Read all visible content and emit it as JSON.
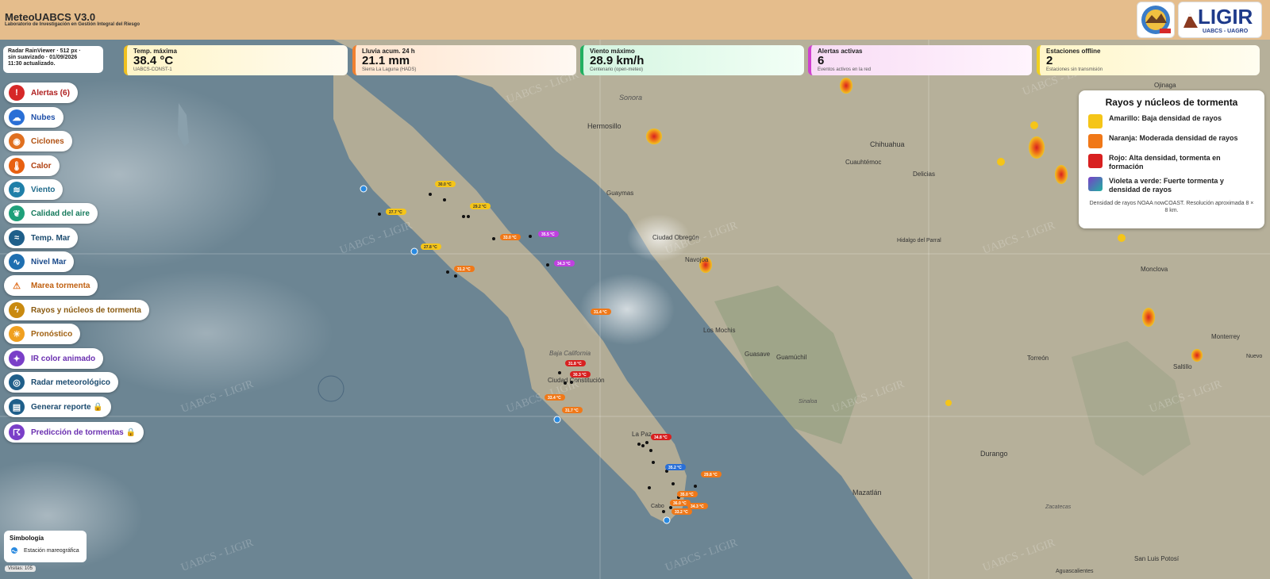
{
  "header": {
    "title": "MeteoUABCS V3.0",
    "subtitle": "Laboratorio de Investigación en Gestión Integral del Riesgo",
    "logo_text": "LIGIR",
    "logo_subtext": "UABCS - UAGRO"
  },
  "radar_info": {
    "line1": "Radar RainViewer · 512 px ·",
    "line2": "sin suavizado · 01/09/2026",
    "line3": "11:30 actualizado."
  },
  "stats": [
    {
      "label": "Temp. máxima",
      "value": "38.4 °C",
      "source": "UABCS-CONST-1",
      "color": "#f0c020"
    },
    {
      "label": "Lluvia acum. 24 h",
      "value": "21.1 mm",
      "source": "Sierra La Laguna (HADS)",
      "color": "#f08030"
    },
    {
      "label": "Viento máximo",
      "value": "28.9 km/h",
      "source": "Centenario (open-meteo)",
      "color": "#20b060"
    },
    {
      "label": "Alertas activas",
      "value": "6",
      "source": "Eventos activos en la red",
      "color": "#d040d0"
    },
    {
      "label": "Estaciones offline",
      "value": "2",
      "source": "Estaciones sin transmisión",
      "color": "#f0d020"
    }
  ],
  "sidebar": [
    {
      "label": "Alertas (6)",
      "icon": "alert-icon",
      "color": "#d62828",
      "text_color": "#b02020"
    },
    {
      "label": "Nubes",
      "icon": "cloud-icon",
      "color": "#2a6fd6",
      "text_color": "#1e4fa8"
    },
    {
      "label": "Ciclones",
      "icon": "cyclone-icon",
      "color": "#e07020",
      "text_color": "#b05010"
    },
    {
      "label": "Calor",
      "icon": "thermometer-icon",
      "color": "#e86010",
      "text_color": "#b04010"
    },
    {
      "label": "Viento",
      "icon": "wind-icon",
      "color": "#1f7fa8",
      "text_color": "#1f6a8a"
    },
    {
      "label": "Calidad del aire",
      "icon": "leaf-icon",
      "color": "#1fa07a",
      "text_color": "#167a5c"
    },
    {
      "label": "Temp. Mar",
      "icon": "sea-thermometer-icon",
      "color": "#1f5f8a",
      "text_color": "#1a4a6e"
    },
    {
      "label": "Nivel Mar",
      "icon": "wave-icon",
      "color": "#1f6fb0",
      "text_color": "#1a4a8a"
    },
    {
      "label": "Marea tormenta",
      "icon": "warning-icon",
      "color": "#ffffff",
      "text_color": "#c06010"
    },
    {
      "label": "Rayos y núcleos de tormenta",
      "icon": "lightning-icon",
      "color": "#c98a10",
      "text_color": "#8a5a10"
    },
    {
      "label": "Pronóstico",
      "icon": "sun-icon",
      "color": "#f0a020",
      "text_color": "#a06010"
    },
    {
      "label": "IR color animado",
      "icon": "satellite-icon",
      "color": "#7a3fc8",
      "text_color": "#6a2fb0"
    },
    {
      "label": "Radar meteorológico",
      "icon": "radar-icon",
      "color": "#1f5f8a",
      "text_color": "#1a4a6e"
    },
    {
      "label": "Generar reporte 🔒",
      "icon": "report-icon",
      "color": "#1f5f8a",
      "text_color": "#1a4a6e"
    },
    {
      "label": "Predicción de tormentas 🔒",
      "icon": "storm-prediction-icon",
      "color": "#7a3fc8",
      "text_color": "#6a2fb0"
    }
  ],
  "legend": {
    "title": "Rayos y núcleos de tormenta",
    "items": [
      {
        "color": "#f5c518",
        "text": "Amarillo: Baja densidad de rayos"
      },
      {
        "color": "#f07818",
        "text": "Naranja: Moderada densidad de rayos"
      },
      {
        "color": "#d82020",
        "text": "Rojo: Alta densidad, tormenta en formación"
      },
      {
        "color": "#5a5ac8",
        "text": "Violeta a verde: Fuerte tormenta y densidad de rayos"
      }
    ],
    "note": "Densidad de rayos NOAA nowCOAST. Resolución aproximada 8 × 8 km."
  },
  "simbologia": {
    "title": "Simbología",
    "item": "Estación mareográfica"
  },
  "visitas": "Visitas: 105",
  "watermark": "UABCS - LIGIR",
  "map_labels": [
    "Sonora",
    "Hermosillo",
    "Chihuahua",
    "Cuauhtémoc",
    "Delicias",
    "Guaymas",
    "Ciudad Obregón",
    "Navojoa",
    "Hidalgo del Parral",
    "Monclova",
    "Los Mochis",
    "Guasave",
    "Guamúchil",
    "Torreón",
    "Saltillo",
    "Monterrey",
    "Sinaloa",
    "Durango",
    "Mazatlán",
    "Zacatecas",
    "Aguascalientes",
    "San Luis Potosí",
    "Baja California",
    "Ciudad Constitución",
    "La Paz",
    "Cabo",
    "Ojinaga",
    "Nuevo"
  ],
  "station_badges": [
    "30.0 °C",
    "29.2 °C",
    "27.7 °C",
    "27.8 °C",
    "31.2 °C",
    "33.0 °C",
    "35.5 °C",
    "34.3 °C",
    "31.4 °C",
    "31.8 °C",
    "30.3 °C",
    "33.4 °C",
    "31.7 °C",
    "34.8 °C",
    "35.2 °C",
    "29.8 °C",
    "35.0 °C",
    "36.0 °C",
    "34.3 °C",
    "33.2 °C"
  ]
}
